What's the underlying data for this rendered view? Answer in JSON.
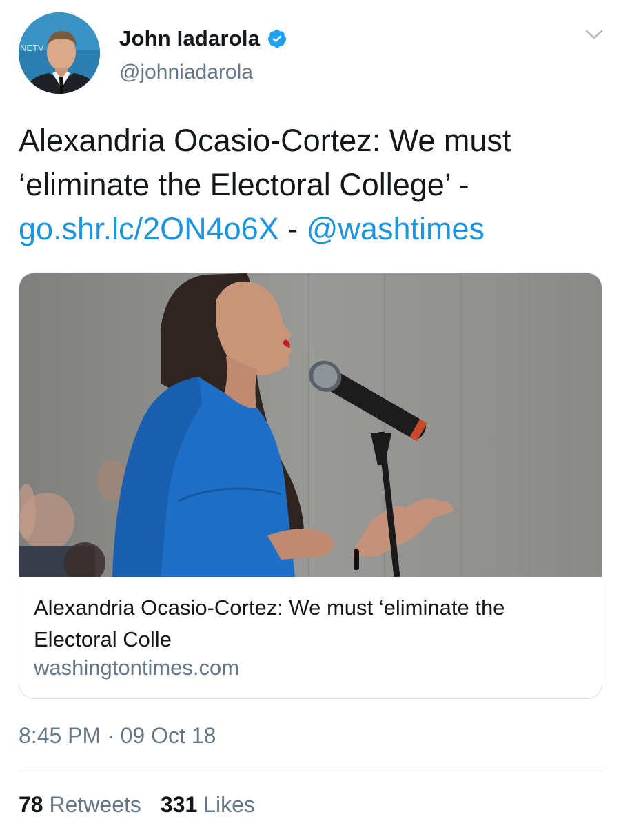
{
  "author": {
    "display_name": "John Iadarola",
    "handle": "@johniadarola",
    "verified": true,
    "avatar_icon": "user-avatar-photo",
    "avatar_overlay_text": "NETV"
  },
  "tweet": {
    "text_before": "Alexandria Ocasio-Cortez: We must ‘eliminate the Electoral College’ -",
    "link_text": "go.shr.lc/2ON4o6X",
    "separator": "-",
    "mention_text": "@washtimes"
  },
  "card": {
    "image_alt": "woman-speaking-at-microphone-photo",
    "title": "Alexandria Ocasio-Cortez: We must ‘eliminate the Electoral Colle",
    "domain": "washingtontimes.com"
  },
  "meta": {
    "timestamp": "8:45 PM · 09 Oct 18"
  },
  "stats": {
    "retweets_count": "78",
    "retweets_label": "Retweets",
    "likes_count": "331",
    "likes_label": "Likes"
  },
  "colors": {
    "link": "#1b95e0",
    "verified": "#1da1f2",
    "secondary_text": "#657786"
  }
}
